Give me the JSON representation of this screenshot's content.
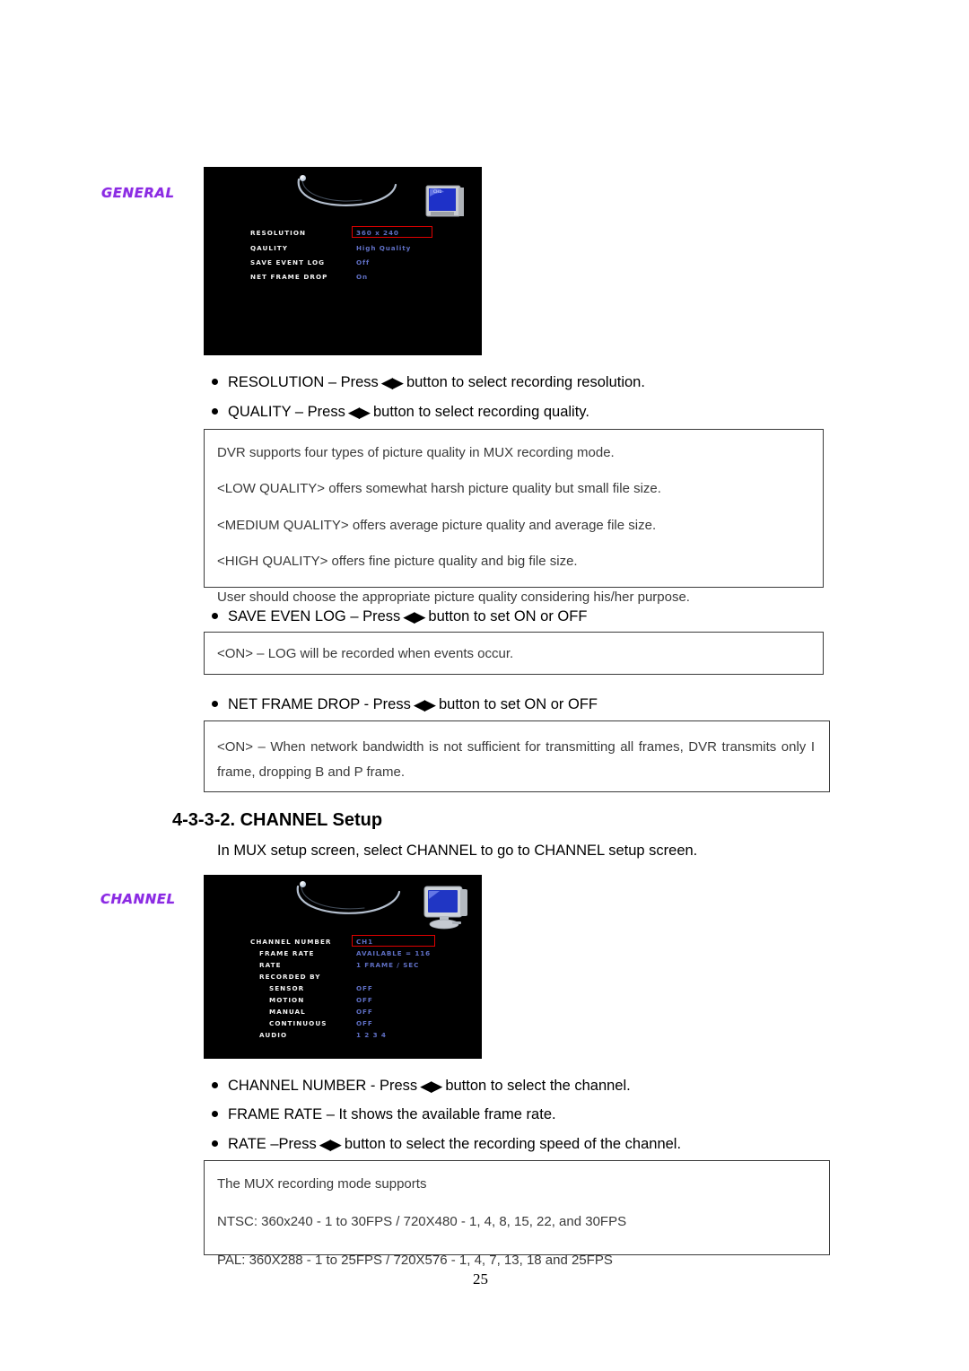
{
  "document": {
    "page_number": "25",
    "heading": "4-3-3-2. CHANNEL Setup",
    "heading_subtext": "In MUX setup screen, select CHANNEL to go to CHANNEL setup screen."
  },
  "general_screen": {
    "logo_text": "GENERAL",
    "monitor_icon": "crt-monitor-icon",
    "rows": [
      {
        "label": "RESOLUTION",
        "value": "360 x 240",
        "highlighted": true
      },
      {
        "label": "QAULITY",
        "value": "High Quality",
        "highlighted": false
      },
      {
        "label": "SAVE EVENT LOG",
        "value": "Off",
        "highlighted": false
      },
      {
        "label": "NET FRAME DROP",
        "value": "On",
        "highlighted": false
      }
    ]
  },
  "channel_screen": {
    "logo_text": "CHANNEL",
    "monitor_icon": "crt-monitor-icon",
    "rows": [
      {
        "label": "CHANNEL NUMBER",
        "value": "CH1",
        "indent": 0,
        "highlighted": true
      },
      {
        "label": "FRAME RATE",
        "value": "AVAILABLE = 116",
        "indent": 1,
        "highlighted": false
      },
      {
        "label": "RATE",
        "value": "1  FRAME / SEC",
        "indent": 1,
        "highlighted": false
      },
      {
        "label": "RECORDED BY",
        "value": "",
        "indent": 1,
        "highlighted": false
      },
      {
        "label": "SENSOR",
        "value": "OFF",
        "indent": 2,
        "highlighted": false
      },
      {
        "label": "MOTION",
        "value": "OFF",
        "indent": 2,
        "highlighted": false
      },
      {
        "label": "MANUAL",
        "value": "OFF",
        "indent": 2,
        "highlighted": false
      },
      {
        "label": "CONTINUOUS",
        "value": "OFF",
        "indent": 2,
        "highlighted": false
      },
      {
        "label": "AUDIO",
        "value": "1  2  3  4",
        "indent": 1,
        "highlighted": false
      }
    ]
  },
  "bullets": {
    "resolution_pre": "RESOLUTION – Press",
    "resolution_post": "button to select recording resolution.",
    "quality_pre": "QUALITY – Press",
    "quality_post": "button to select recording quality.",
    "save_event_log_pre": "SAVE EVEN LOG – Press",
    "save_event_log_post": "button to set ON or OFF",
    "net_frame_drop_pre": "NET FRAME DROP - Press",
    "net_frame_drop_post": "button to set ON or OFF",
    "channel_number_pre": "CHANNEL NUMBER - Press",
    "channel_number_post": "button to select the channel.",
    "frame_rate": "FRAME RATE – It shows the available frame rate.",
    "rate_pre": "RATE –Press",
    "rate_post": "button to select the recording speed of the channel.",
    "arrows_glyph": "◀▶"
  },
  "quality_box": {
    "line1": "DVR supports four types of picture quality in MUX recording mode.",
    "line2": "<LOW QUALITY> offers somewhat harsh picture quality but small file size.",
    "line3": "<MEDIUM QUALITY> offers average picture quality and average file size.",
    "line4": "<HIGH QUALITY> offers fine picture quality and big file size.",
    "line5": "User should choose the appropriate picture quality considering his/her purpose."
  },
  "save_log_box": {
    "line1": "<ON> – LOG will be recorded when events occur."
  },
  "net_frame_box": {
    "line1": "<ON> – When network bandwidth is not sufficient for transmitting all frames, DVR transmits only I frame, dropping B and P frame."
  },
  "mux_box": {
    "line1": "The MUX recording mode supports",
    "line2": "NTSC: 360x240 - 1 to 30FPS / 720X480 - 1, 4, 8, 15, 22, and 30FPS",
    "line3": "PAL: 360X288 - 1 to 25FPS / 720X576 - 1, 4, 7, 13, 18 and 25FPS"
  },
  "colors": {
    "dvr_background": "#000000",
    "dvr_label": "#f2f2f2",
    "dvr_value": "#5f6fc4",
    "highlight_border": "#e00000",
    "logo_purple": "#8a2be2",
    "box_border": "#3a3a3a",
    "body_text": "#000000"
  }
}
